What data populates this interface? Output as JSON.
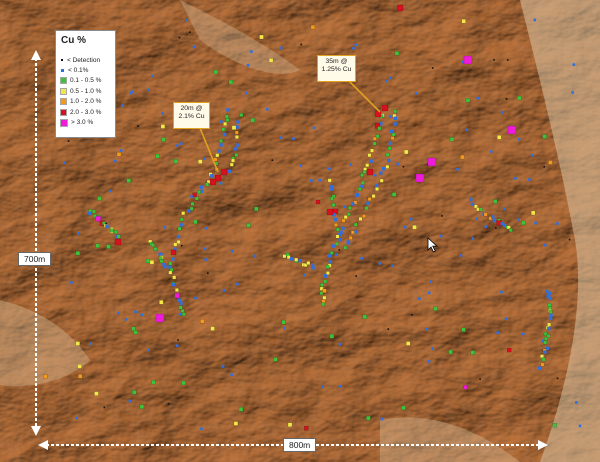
{
  "legend": {
    "title": "Cu %",
    "items": [
      {
        "label": "< Detection",
        "color": "#111111",
        "kind": "small"
      },
      {
        "label": "< 0.1%",
        "color": "#2f6fe0",
        "kind": "square"
      },
      {
        "label": "0.1 - 0.5 %",
        "color": "#3fc23a",
        "kind": "square"
      },
      {
        "label": "0.5 - 1.0 %",
        "color": "#f2e84a",
        "kind": "square"
      },
      {
        "label": "1.0 - 2.0 %",
        "color": "#f29a1e",
        "kind": "square"
      },
      {
        "label": "2.0 - 3.0 %",
        "color": "#d6121f",
        "kind": "square"
      },
      {
        "label": "> 3.0 %",
        "color": "#ee1cd8",
        "kind": "square"
      }
    ]
  },
  "callouts": [
    {
      "line1": "20m @",
      "line2": "2.1% Cu"
    },
    {
      "line1": "35m @",
      "line2": "1.25% Cu"
    }
  ],
  "scale": {
    "vertical_label": "700m",
    "horizontal_label": "800m"
  }
}
